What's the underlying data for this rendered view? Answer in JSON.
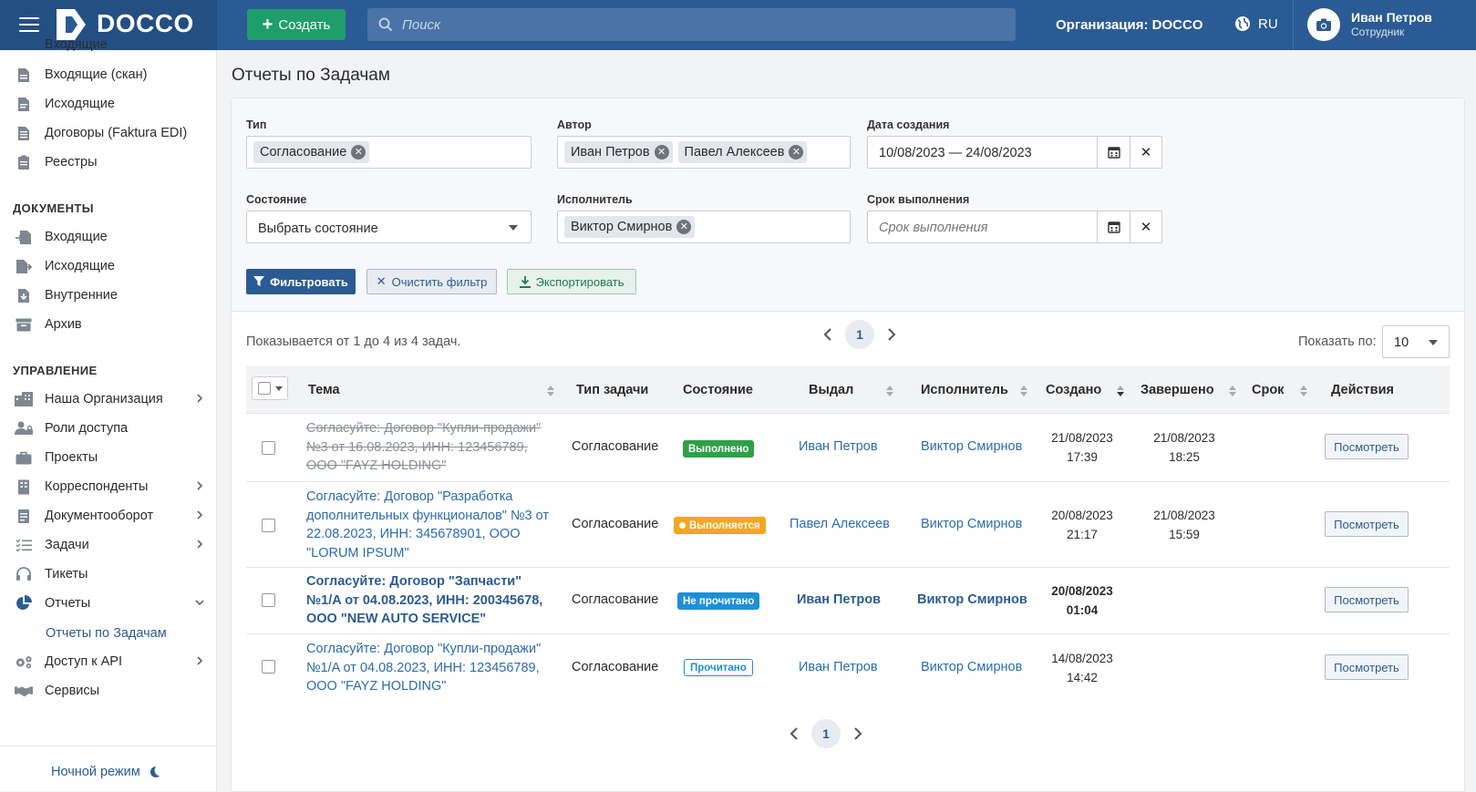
{
  "app": {
    "logo": "DOCCO"
  },
  "topbar": {
    "create_label": "Создать",
    "search_placeholder": "Поиск",
    "organization": "Организация: DOCCO",
    "language": "RU",
    "user_name": "Иван Петров",
    "user_role": "Сотрудник"
  },
  "sidebar": {
    "partial_item": "Входящие",
    "top_items": [
      {
        "label": "Входящие (скан)",
        "icon": "file-scan-icon"
      },
      {
        "label": "Исходящие",
        "icon": "file-out-icon"
      },
      {
        "label": "Договоры (Faktura EDI)",
        "icon": "contract-icon"
      },
      {
        "label": "Реестры",
        "icon": "registry-icon"
      }
    ],
    "documents_header": "ДОКУМЕНТЫ",
    "documents_items": [
      {
        "label": "Входящие",
        "icon": "doc-in-icon"
      },
      {
        "label": "Исходящие",
        "icon": "doc-out-icon"
      },
      {
        "label": "Внутренние",
        "icon": "doc-internal-icon"
      },
      {
        "label": "Архив",
        "icon": "archive-icon"
      }
    ],
    "management_header": "УПРАВЛЕНИЕ",
    "management_items": [
      {
        "label": "Наша Организация",
        "icon": "building-icon",
        "chevron": true
      },
      {
        "label": "Роли доступа",
        "icon": "users-lock-icon",
        "chevron": false
      },
      {
        "label": "Проекты",
        "icon": "briefcase-icon",
        "chevron": false
      },
      {
        "label": "Корреспонденты",
        "icon": "office-icon",
        "chevron": true
      },
      {
        "label": "Документооборот",
        "icon": "docflow-icon",
        "chevron": true
      },
      {
        "label": "Задачи",
        "icon": "tasks-icon",
        "chevron": true
      },
      {
        "label": "Тикеты",
        "icon": "headset-icon",
        "chevron": false
      },
      {
        "label": "Отчеты",
        "icon": "pie-chart-icon",
        "chevron": "down"
      }
    ],
    "reports_sub": "Отчеты по Задачам",
    "bottom_items": [
      {
        "label": "Доступ к API",
        "icon": "cogs-icon",
        "chevron": true
      },
      {
        "label": "Сервисы",
        "icon": "handshake-icon",
        "chevron": false
      }
    ],
    "night_mode": "Ночной режим"
  },
  "page": {
    "title": "Отчеты по Задачам"
  },
  "filters": {
    "type_label": "Тип",
    "type_tags": [
      "Согласование"
    ],
    "author_label": "Автор",
    "author_tags": [
      "Иван Петров",
      "Павел Алексеев"
    ],
    "created_label": "Дата создания",
    "created_value": "10/08/2023 — 24/08/2023",
    "state_label": "Состояние",
    "state_value": "Выбрать состояние",
    "executor_label": "Исполнитель",
    "executor_tags": [
      "Виктор Смирнов"
    ],
    "due_label": "Срок выполнения",
    "due_placeholder": "Срок выполнения",
    "filter_btn": "Фильтровать",
    "clear_btn": "Очистить фильтр",
    "export_btn": "Экспортировать"
  },
  "table": {
    "showing": "Показывается от 1 до 4 из 4 задач.",
    "page": "1",
    "per_page_label": "Показать по:",
    "per_page_value": "10",
    "headers": {
      "subject": "Тема",
      "task_type": "Тип задачи",
      "state": "Состояние",
      "issued": "Выдал",
      "executor": "Исполнитель",
      "created": "Создано",
      "completed": "Завершено",
      "due": "Срок",
      "actions": "Действия"
    },
    "rows": [
      {
        "subject": "Согласуйте: Договор \"Купли-продажи\" №3 от 16.08.2023, ИНН: 123456789, ООО \"FAYZ HOLDING\"",
        "task_type": "Согласование",
        "state": "Выполнено",
        "issued": "Иван Петров",
        "executor": "Виктор Смирнов",
        "created_date": "21/08/2023",
        "created_time": "17:39",
        "completed_date": "21/08/2023",
        "completed_time": "18:25",
        "action": "Посмотреть"
      },
      {
        "subject": "Согласуйте: Договор \"Разработка дополнительных функционалов\" №3 от 22.08.2023, ИНН: 345678901, ООО \"LORUM IPSUM\"",
        "task_type": "Согласование",
        "state": "Выполняется",
        "issued": "Павел Алексеев",
        "executor": "Виктор Смирнов",
        "created_date": "20/08/2023",
        "created_time": "21:17",
        "completed_date": "21/08/2023",
        "completed_time": "15:59",
        "action": "Посмотреть"
      },
      {
        "subject": "Согласуйте: Договор \"Запчасти\" №1/A от 04.08.2023, ИНН: 200345678, ООО \"NEW AUTO SERVICE\"",
        "task_type": "Согласование",
        "state": "Не прочитано",
        "issued": "Иван Петров",
        "executor": "Виктор Смирнов",
        "created_date": "20/08/2023",
        "created_time": "01:04",
        "completed_date": "",
        "completed_time": "",
        "action": "Посмотреть"
      },
      {
        "subject": "Согласуйте: Договор \"Купли-продажи\" №1/A от 04.08.2023, ИНН: 123456789, ООО \"FAYZ HOLDING\"",
        "task_type": "Согласование",
        "state": "Прочитано",
        "issued": "Иван Петров",
        "executor": "Виктор Смирнов",
        "created_date": "14/08/2023",
        "created_time": "14:42",
        "completed_date": "",
        "completed_time": "",
        "action": "Посмотреть"
      }
    ]
  },
  "colors": {
    "primary": "#2b5b94",
    "header": "#2b5b94",
    "success": "#2fa04a",
    "warning": "#f5a623",
    "info": "#1e90d6"
  }
}
